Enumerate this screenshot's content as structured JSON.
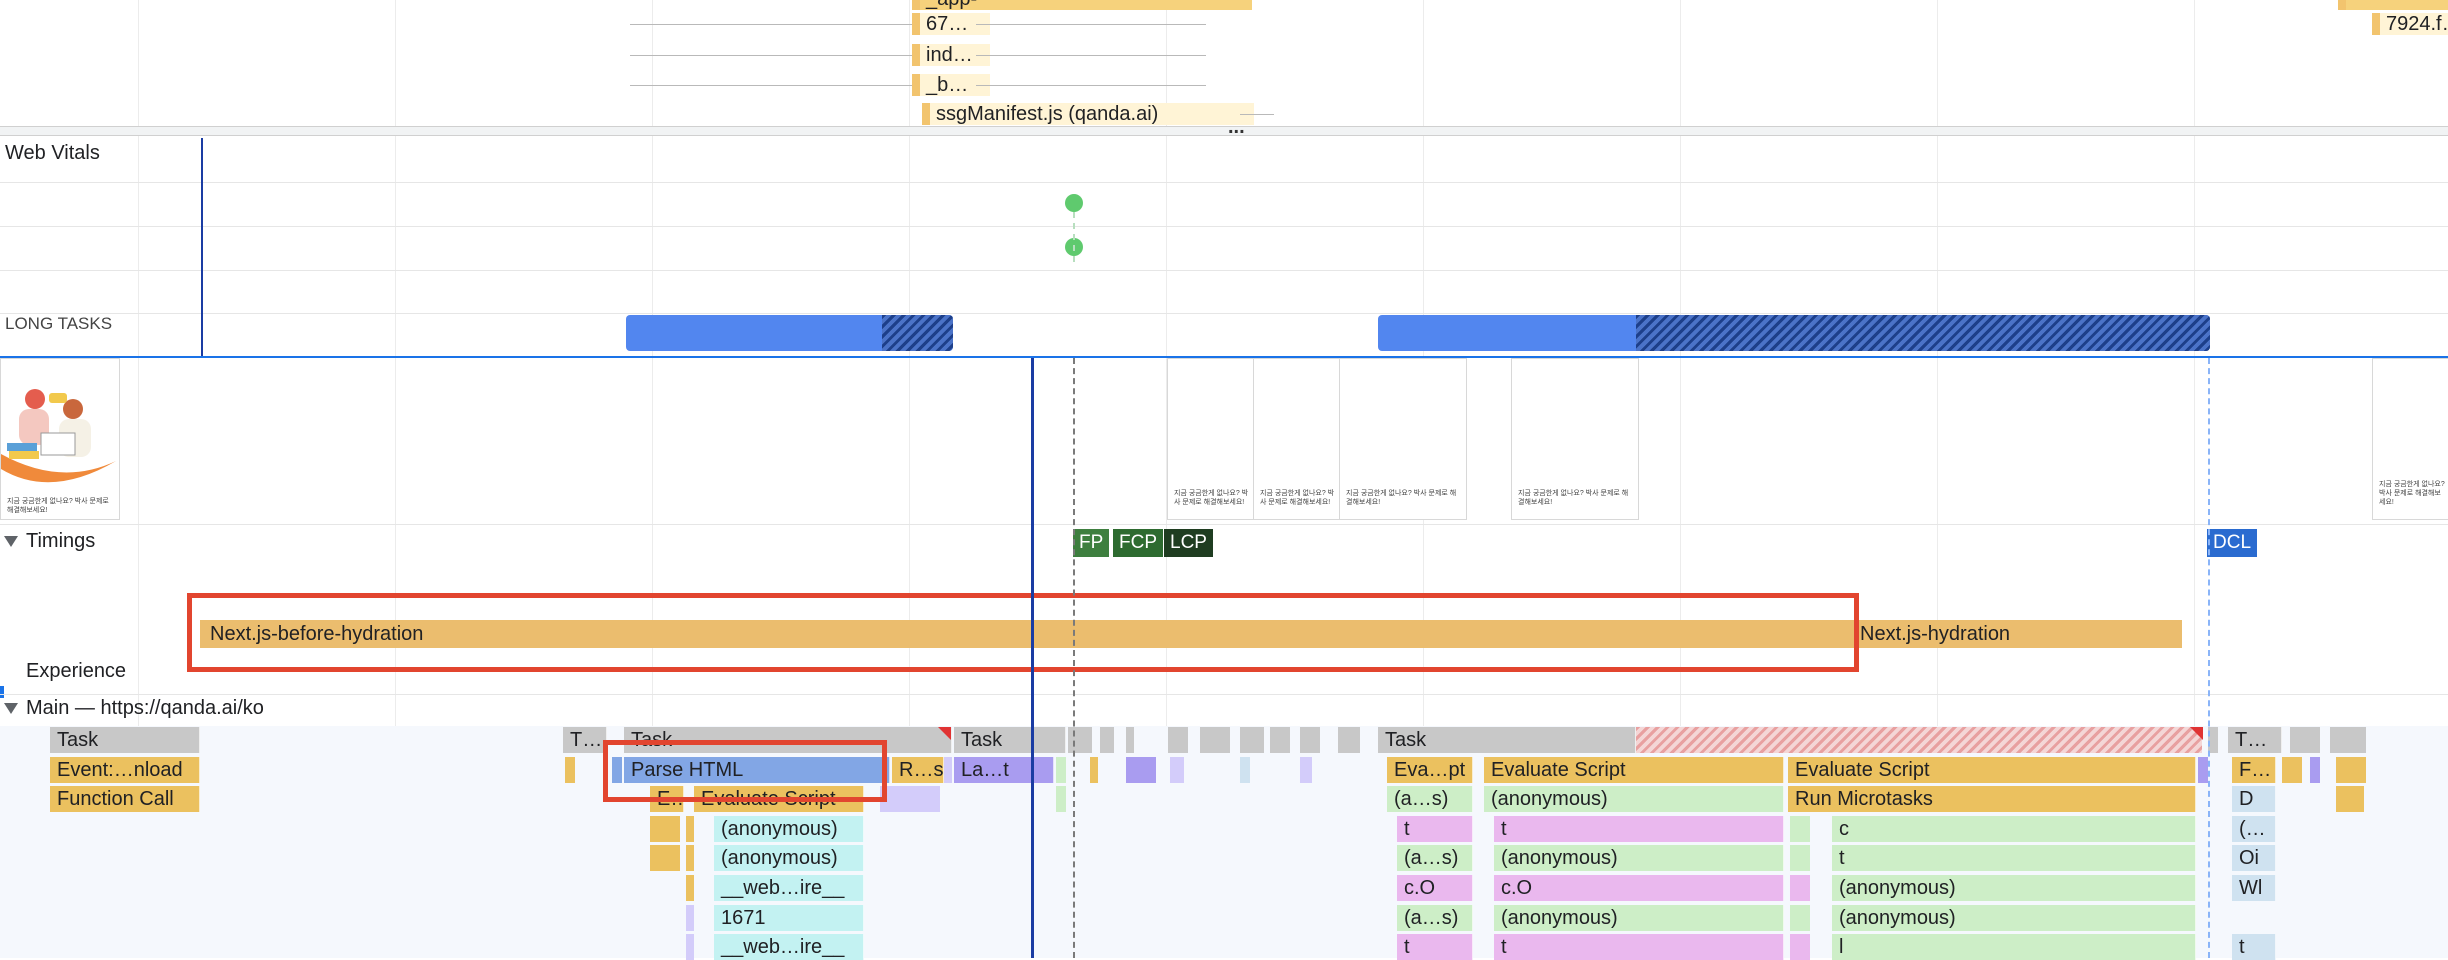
{
  "network": {
    "requests": [
      {
        "label": "_app-"
      },
      {
        "label": "67…"
      },
      {
        "label": "ind…"
      },
      {
        "label": "_b…"
      },
      {
        "label": "ssgManifest.js (qanda.ai)"
      },
      {
        "label": "7924.f…"
      }
    ],
    "resize_handle": "..."
  },
  "tracks": {
    "web_vitals": "Web Vitals",
    "long_tasks": "LONG TASKS",
    "timings": "Timings",
    "experience": "Experience",
    "main": "Main — https://qanda.ai/ko"
  },
  "markers": {
    "fp": "FP",
    "fcp": "FCP",
    "lcp": "LCP",
    "dcl": "DCL"
  },
  "colors": {
    "fp": "#3e7f3f",
    "fcp": "#2e6b30",
    "lcp": "#1f3d21",
    "dcl": "#2a6bd0",
    "highlight_box": "#e2452f",
    "playhead": "#1a3ca3",
    "long_task": "#5286ef"
  },
  "timings": {
    "before_hydration": "Next.js-before-hydration",
    "hydration": "Next.js-hydration"
  },
  "screenshot_caption": "지금 궁금한게 없나요? 박사 문제로 해결해보세요!",
  "flame": {
    "row1": {
      "task1": "Task",
      "t_small": "T…",
      "task2": "Task",
      "task3": "Task",
      "task4": "Task",
      "t_end": "T…"
    },
    "row2": {
      "event_unload": "Event:…nload",
      "parse_html": "Parse HTML",
      "r_s": "R…s",
      "la_t": "La…t",
      "eva_pt": "Eva…pt",
      "evaluate_script_a": "Evaluate Script",
      "evaluate_script_b": "Evaluate Script",
      "f_end": "F…"
    },
    "row3": {
      "function_call": "Function Call",
      "e_small": "E…",
      "evaluate_script": "Evaluate Script",
      "a_s": "(a…s)",
      "anonymous": "(anonymous)",
      "run_microtasks": "Run Microtasks",
      "d": "D"
    },
    "row4": {
      "anonymous": "(anonymous)",
      "t1": "t",
      "t2": "t",
      "c": "c",
      "paren": "(…"
    },
    "row5": {
      "anonymous": "(anonymous)",
      "a_s": "(a…s)",
      "anonymous2": "(anonymous)",
      "t": "t",
      "oi": "Oi"
    },
    "row6": {
      "web_ire": "__web…ire__",
      "c_o1": "c.O",
      "c_o2": "c.O",
      "anonymous": "(anonymous)",
      "wl": "Wl"
    },
    "row7": {
      "n1671": "1671",
      "a_s": "(a…s)",
      "anonymous": "(anonymous)",
      "anonymous2": "(anonymous)"
    },
    "row8": {
      "web_ire": "__web…ire__",
      "t1": "t",
      "t2": "t",
      "l": "l",
      "t3": "t"
    }
  }
}
